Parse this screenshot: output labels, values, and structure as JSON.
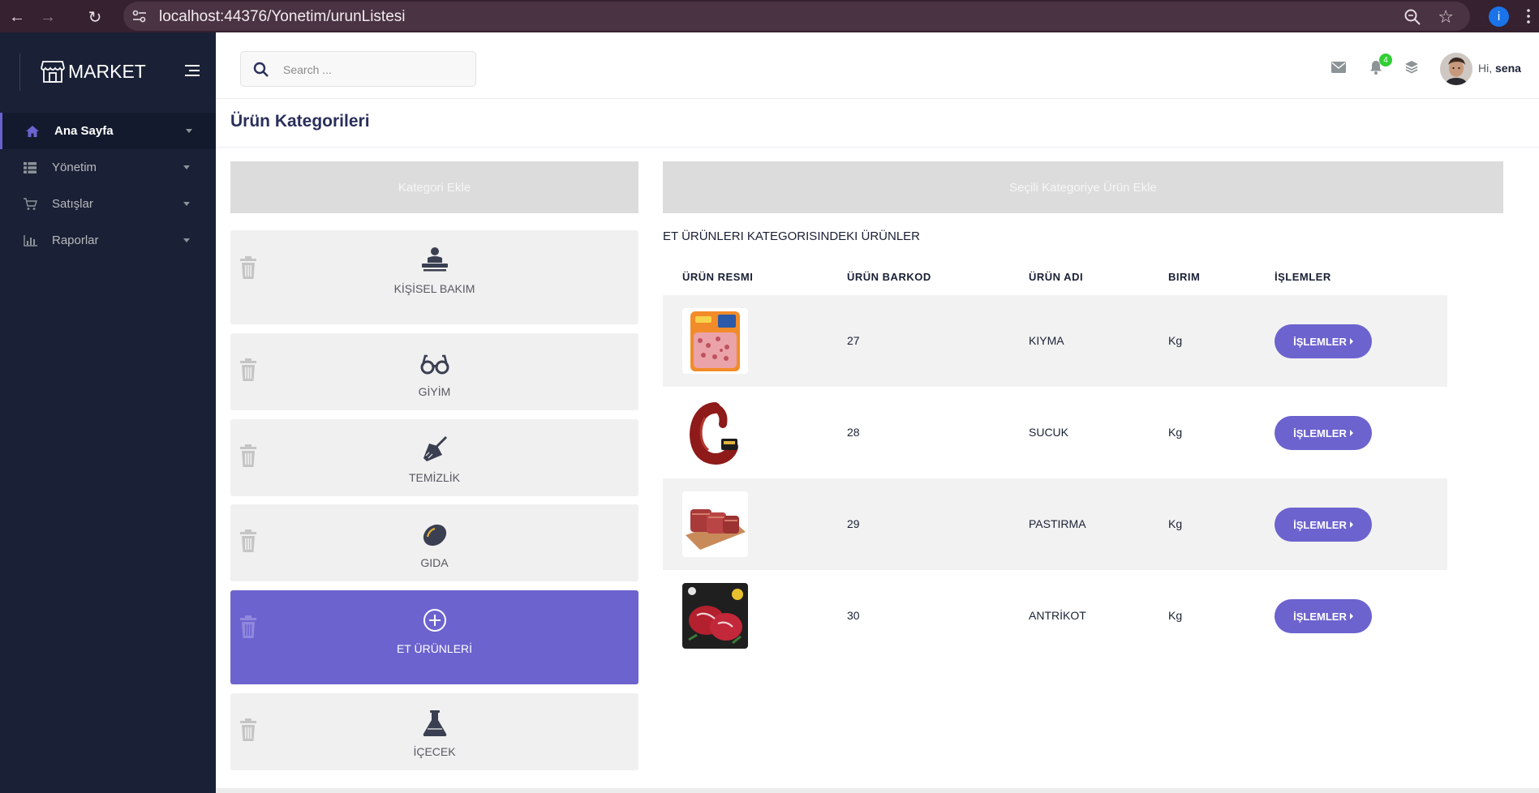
{
  "browser": {
    "url": "localhost:44376/Yonetim/urunListesi",
    "profile_initial": "i"
  },
  "sidebar": {
    "brand": "MARKET",
    "items": [
      {
        "label": "Ana Sayfa",
        "icon": "home-icon",
        "active": true
      },
      {
        "label": "Yönetim",
        "icon": "table-icon",
        "active": false
      },
      {
        "label": "Satışlar",
        "icon": "cart-icon",
        "active": false
      },
      {
        "label": "Raporlar",
        "icon": "bar-chart-icon",
        "active": false
      }
    ]
  },
  "header": {
    "search_placeholder": "Search ...",
    "notification_count": "4",
    "greeting_prefix": "Hi,",
    "user_name": "sena"
  },
  "page": {
    "title": "Ürün Kategorileri",
    "add_category_label": "Kategori Ekle",
    "add_product_label": "Seçili Kategoriye Ürün Ekle"
  },
  "categories": [
    {
      "label": "KİŞİSEL BAKIM",
      "icon": "person-care-icon",
      "active": false
    },
    {
      "label": "GİYİM",
      "icon": "glasses-icon",
      "active": false
    },
    {
      "label": "TEMİZLİK",
      "icon": "broom-icon",
      "active": false
    },
    {
      "label": "GIDA",
      "icon": "lemon-icon",
      "active": false
    },
    {
      "label": "ET ÜRÜNLERİ",
      "icon": "plus-circle-icon",
      "active": true
    },
    {
      "label": "İÇECEK",
      "icon": "flask-icon",
      "active": false
    }
  ],
  "products": {
    "section_title": "ET ÜRÜNLERI KATEGORISINDEKI ÜRÜNLER",
    "columns": [
      "ÜRÜN RESMI",
      "ÜRÜN BARKOD",
      "ÜRÜN ADI",
      "BIRIM",
      "İŞLEMLER"
    ],
    "rows": [
      {
        "barcode": "27",
        "name": "KIYMA",
        "unit": "Kg",
        "action": "İŞLEMLER",
        "image": "ground-meat-package"
      },
      {
        "barcode": "28",
        "name": "SUCUK",
        "unit": "Kg",
        "action": "İŞLEMLER",
        "image": "sausage-ring"
      },
      {
        "barcode": "29",
        "name": "PASTIRMA",
        "unit": "Kg",
        "action": "İŞLEMLER",
        "image": "pastrami-slices"
      },
      {
        "barcode": "30",
        "name": "ANTRİKOT",
        "unit": "Kg",
        "action": "İŞLEMLER",
        "image": "steak-board"
      }
    ]
  },
  "colors": {
    "sidebar_bg": "#1a2035",
    "accent": "#6c63cf",
    "badge_green": "#31ce36",
    "browser_bar": "#35212f"
  }
}
